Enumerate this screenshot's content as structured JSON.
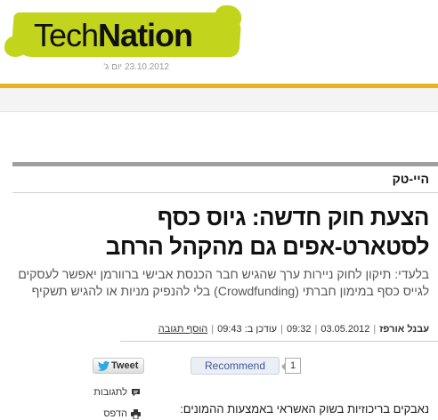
{
  "header": {
    "logo_light": "Tech",
    "logo_bold": "Nation",
    "date": "23.10.2012 יום ג'"
  },
  "colors": {
    "logo_accent": "#c3d41c",
    "header_rule": "#e9b41a",
    "article_rule": "#9f9f9f",
    "facebook_blue": "#3b5998"
  },
  "article": {
    "section": "היי-טק",
    "headline": "הצעת חוק חדשה: גיוס כסף לסטארט-אפים גם מהקהל הרחב",
    "lede": "בלעדי: תיקון לחוק ניירות ערך שהגיש חבר הכנסת אבישי ברוורמן יאפשר לעסקים לגייס כסף במימון חברתי (Crowdfunding) בלי להנפיק מניות או להגיש תשקיף",
    "meta": {
      "author": "עבנל אורפז",
      "date": "03.05.2012",
      "time": "09:32",
      "updated": "עודכן ב: 09:43",
      "add_comment": "הוסף תגובה"
    },
    "body_start": "נאבקים בריכוזיות בשוק האשראי באמצעות ההמונים:"
  },
  "social": {
    "tweet_label": "Tweet",
    "recommend_label": "Recommend",
    "recommend_count": "1"
  },
  "tools": {
    "comments_label": "לתגובות",
    "print_label": "הדפס",
    "comments_icon": "speech-bubble-icon",
    "print_icon": "printer-icon"
  }
}
